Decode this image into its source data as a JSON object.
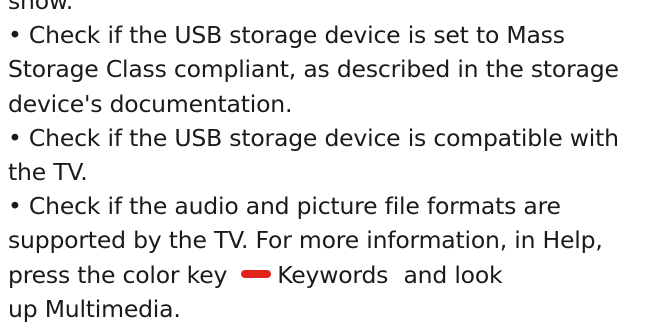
{
  "document": {
    "partial_top": "show.",
    "bullet1": {
      "line1": "• Check if the USB storage device is set to Mass",
      "line2": "Storage Class compliant, as described in the storage",
      "line3": "device's documentation."
    },
    "bullet2": {
      "line1": "• Check if the USB storage device is compatible with",
      "line2": "the TV."
    },
    "bullet3": {
      "line1": "• Check if the audio and picture file formats are",
      "line2_pre": "supported by the TV. For more information, in ",
      "help_link": "Help",
      "line2_post": ",",
      "line3_pre": "press the color key",
      "color_key": "red-key-icon",
      "keywords_link": "Keywords",
      "line3_post": " and look",
      "line4_pre": "up ",
      "multimedia_link": "Multimedia",
      "line4_post": "."
    }
  },
  "colors": {
    "text": "#1a1a1a",
    "red_key": "#e2231a"
  }
}
